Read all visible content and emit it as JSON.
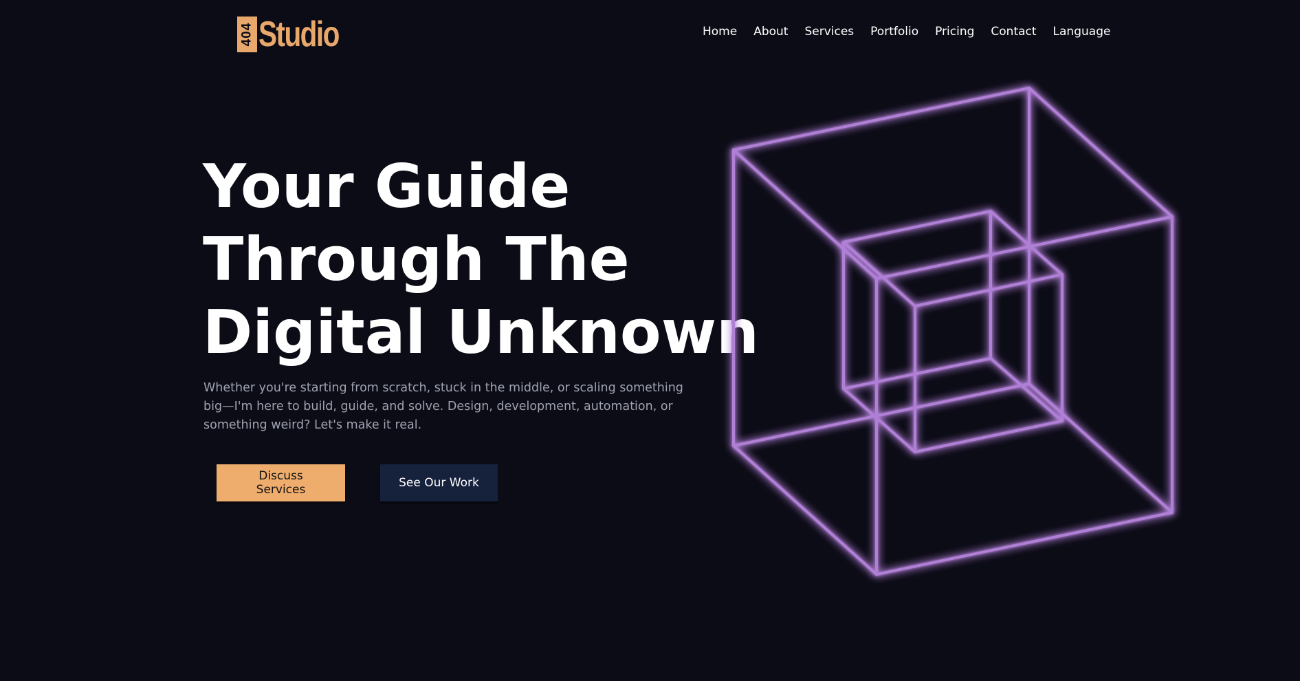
{
  "logo": {
    "badge_text": "404",
    "word": "Studio",
    "color": "#e9a86b"
  },
  "nav": {
    "items": [
      "Home",
      "About",
      "Services",
      "Portfolio",
      "Pricing",
      "Contact",
      "Language"
    ]
  },
  "hero": {
    "title_lines": [
      "Your Guide",
      "Through The",
      "Digital Unknown"
    ],
    "subtitle": "Whether you're starting from scratch, stuck in the middle, or scaling something big—I'm here to build, guide, and solve. Design, development, automation, or something weird? Let's make it real.",
    "primary_button": "Discuss Services",
    "secondary_button": "See Our Work"
  },
  "colors": {
    "background": "#0c0c16",
    "accent": "#efad6d",
    "secondary_button_bg": "#16213c",
    "cube_stroke": "#b07fd6"
  },
  "decoration": {
    "icon": "neon-wireframe-cube-icon"
  }
}
